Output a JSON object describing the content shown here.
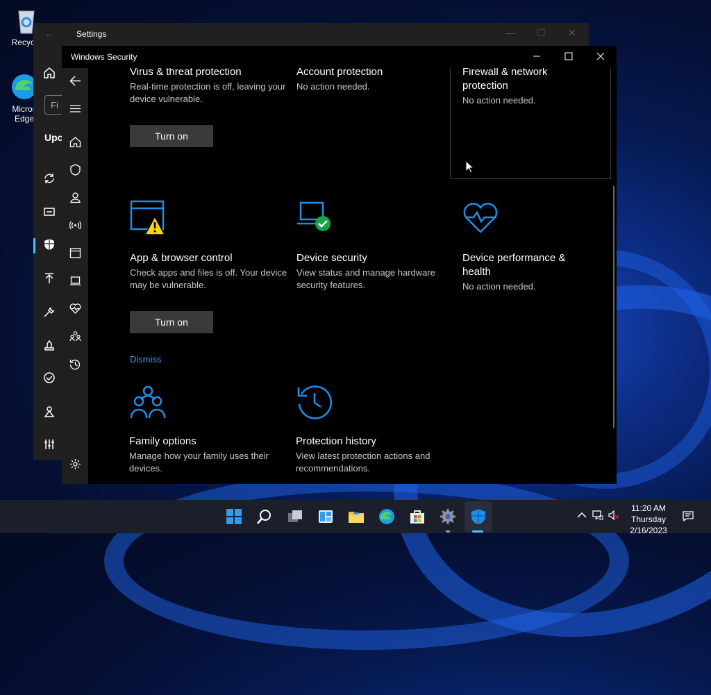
{
  "desktop": {
    "icons": [
      {
        "label": "Recycle"
      },
      {
        "label_line1": "Micros",
        "label_line2": "Edge"
      }
    ]
  },
  "settings_window": {
    "title": "Settings",
    "search_placeholder": "Fi",
    "section_heading": "Upc"
  },
  "winsec": {
    "title": "Windows Security",
    "tiles": [
      {
        "name": "Virus & threat protection",
        "desc": "Real-time protection is off, leaving your device vulnerable.",
        "button": "Turn on"
      },
      {
        "name": "Account protection",
        "desc": "No action needed."
      },
      {
        "name": "Firewall & network protection",
        "desc": "No action needed."
      },
      {
        "name": "App & browser control",
        "desc": "Check apps and files is off. Your device may be vulnerable.",
        "button": "Turn on",
        "link": "Dismiss"
      },
      {
        "name": "Device security",
        "desc": "View status and manage hardware security features."
      },
      {
        "name": "Device performance & health",
        "desc": "No action needed."
      },
      {
        "name": "Family options",
        "desc": "Manage how your family uses their devices."
      },
      {
        "name": "Protection history",
        "desc": "View latest protection actions and recommendations."
      }
    ]
  },
  "taskbar": {
    "time": "11:20 AM",
    "day": "Thursday",
    "date": "2/16/2023"
  },
  "colors": {
    "accent_blue": "#1e8fe8",
    "warning_yellow": "#ffd500",
    "ok_green": "#16a34a",
    "button_bg": "#3a3a3a",
    "link": "#4a9be8"
  }
}
